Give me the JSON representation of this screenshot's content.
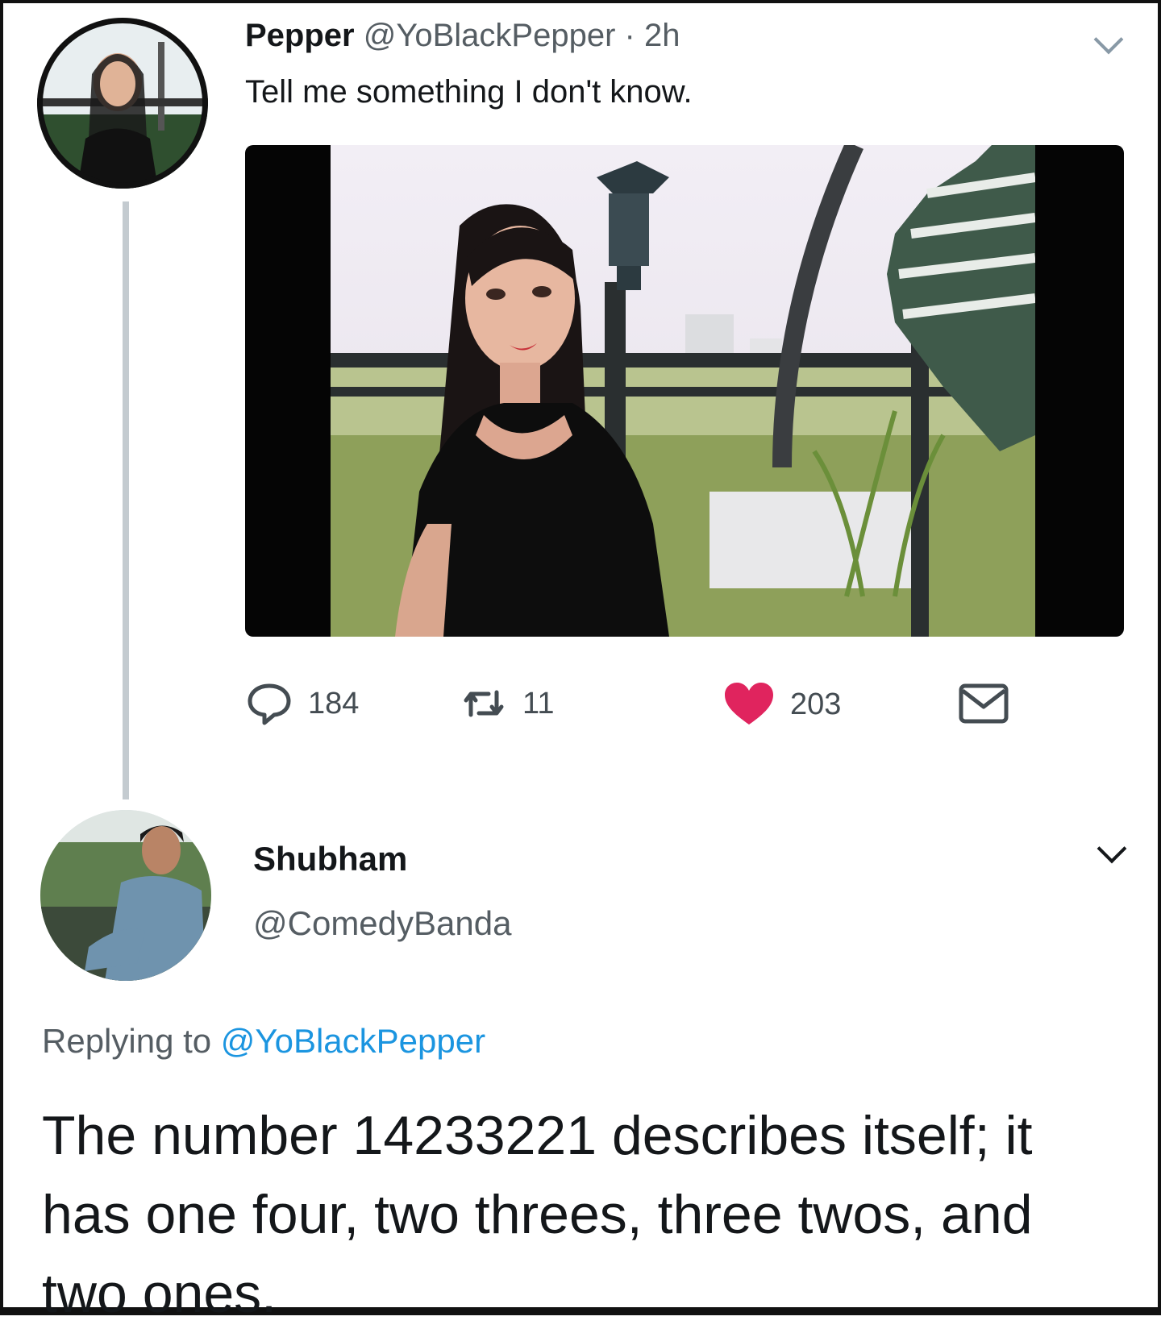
{
  "tweet": {
    "author_name": "Pepper",
    "author_handle": "@YoBlackPepper",
    "separator": "·",
    "time": "2h",
    "text": "Tell me something I don't know.",
    "actions": {
      "replies": "184",
      "retweets": "11",
      "likes": "203"
    }
  },
  "reply": {
    "author_name": "Shubham",
    "author_handle": "@ComedyBanda",
    "replying_prefix": "Replying to",
    "replying_to": "@YoBlackPepper",
    "text": "The number 14233221 describes itself; it has one four, two threes, three twos, and two ones."
  },
  "icons": {
    "reply": "speech-bubble-icon",
    "retweet": "retweet-icon",
    "like": "heart-icon",
    "message": "envelope-icon",
    "menu": "chevron-down-icon"
  },
  "colors": {
    "like_active": "#e0245e",
    "link": "#1b95e0",
    "muted": "#555d63",
    "thread_line": "#c4cbd0"
  }
}
